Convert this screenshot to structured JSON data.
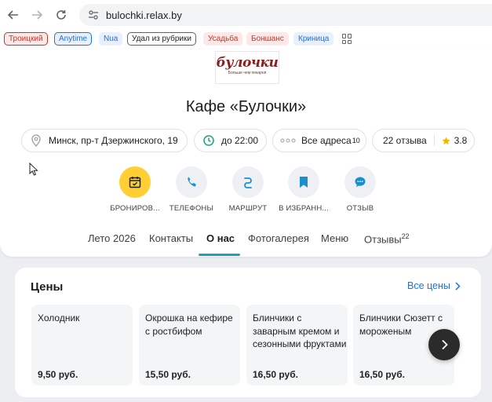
{
  "browser": {
    "url": "bulochki.relax.by",
    "bookmarks": [
      {
        "label": "Троицкий",
        "color": "#d93025",
        "bg": "#fce8e6"
      },
      {
        "label": "Anytime",
        "color": "#1a73e8",
        "bg": "#e8f0fe"
      },
      {
        "label": "Nua",
        "color": "#1a73e8",
        "bg": "#e8f0fe"
      },
      {
        "label": "Удал из рубрики",
        "color": "#202124",
        "bg": "#ffffff"
      },
      {
        "label": "Усадьба",
        "color": "#d93025",
        "bg": "#fce8e6"
      },
      {
        "label": "Боншанс",
        "color": "#d93025",
        "bg": "#fce8e6"
      },
      {
        "label": "Криница",
        "color": "#1a73e8",
        "bg": "#e8f0fe"
      }
    ]
  },
  "logo": {
    "brand": "булочки",
    "slogan": "Больше чем пекарня"
  },
  "title": "Кафе «Булочки»",
  "info": {
    "address": "Минск, пр-т Дзержинского, 19",
    "hours": "до 22:00",
    "addresses_label": "Все адреса",
    "addresses_count": "10",
    "reviews": "22 отзыва",
    "rating": "3.8"
  },
  "actions": [
    {
      "label": "БРОНИРОВ...",
      "icon": "calendar-icon"
    },
    {
      "label": "ТЕЛЕФОНЫ",
      "icon": "phone-icon"
    },
    {
      "label": "МАРШРУТ",
      "icon": "route-icon"
    },
    {
      "label": "В ИЗБРАНН...",
      "icon": "bookmark-icon"
    },
    {
      "label": "ОТЗЫВ",
      "icon": "chat-icon"
    }
  ],
  "tabs": [
    {
      "label": "Лето 2026"
    },
    {
      "label": "Контакты"
    },
    {
      "label": "О нас",
      "active": true
    },
    {
      "label": "Фотогалерея"
    },
    {
      "label": "Меню"
    },
    {
      "label": "Отзывы",
      "count": "22"
    }
  ],
  "prices": {
    "heading": "Цены",
    "all_label": "Все цены",
    "items": [
      {
        "name": "Холодник",
        "price": "9,50 руб."
      },
      {
        "name": "Окрошка на кефире с ростбифом",
        "price": "15,50 руб."
      },
      {
        "name": "Блинчики с заварным кремом и сезонными фруктами",
        "price": "16,50 руб."
      },
      {
        "name": "Блинчики Сюзетт с мороженым",
        "price": "16,50 руб."
      }
    ]
  },
  "colors": {
    "accent": "#1aa0c4",
    "yellow": "#ffcf33",
    "link": "#1a73e8",
    "icon_blue": "#1a8fd0"
  }
}
